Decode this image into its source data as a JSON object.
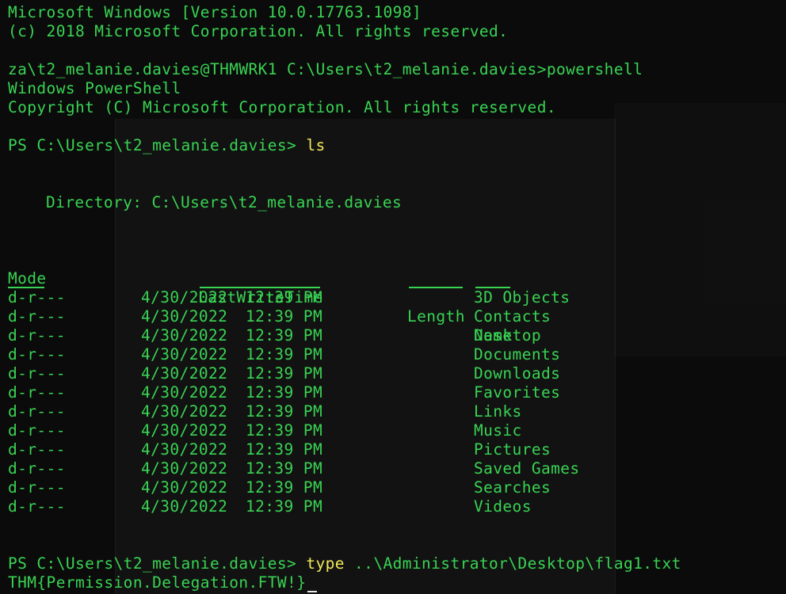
{
  "header": {
    "line1": "Microsoft Windows [Version 10.0.17763.1098]",
    "line2": "(c) 2018 Microsoft Corporation. All rights reserved."
  },
  "session": {
    "cmd_prompt": "za\\t2_melanie.davies@THMWRK1 C:\\Users\\t2_melanie.davies>",
    "cmd_command": "powershell",
    "ps_title": "Windows PowerShell",
    "ps_copyright": "Copyright (C) Microsoft Corporation. All rights reserved.",
    "ps_prompt": "PS C:\\Users\\t2_melanie.davies> ",
    "ls_command": "ls",
    "type_command": "type",
    "type_arg": "..\\Administrator\\Desktop\\flag1.txt",
    "flag_output": "THM{Permission.Delegation.FTW!}"
  },
  "listing": {
    "directory_label": "Directory: C:\\Users\\t2_melanie.davies",
    "headers": {
      "mode": "Mode",
      "last_write_time": "LastWriteTime",
      "length": "Length",
      "name": "Name"
    },
    "rows": [
      {
        "mode": "d-r---",
        "date": "4/30/2022",
        "time": "12:39 PM",
        "length": "",
        "name": "3D Objects"
      },
      {
        "mode": "d-r---",
        "date": "4/30/2022",
        "time": "12:39 PM",
        "length": "",
        "name": "Contacts"
      },
      {
        "mode": "d-r---",
        "date": "4/30/2022",
        "time": "12:39 PM",
        "length": "",
        "name": "Desktop"
      },
      {
        "mode": "d-r---",
        "date": "4/30/2022",
        "time": "12:39 PM",
        "length": "",
        "name": "Documents"
      },
      {
        "mode": "d-r---",
        "date": "4/30/2022",
        "time": "12:39 PM",
        "length": "",
        "name": "Downloads"
      },
      {
        "mode": "d-r---",
        "date": "4/30/2022",
        "time": "12:39 PM",
        "length": "",
        "name": "Favorites"
      },
      {
        "mode": "d-r---",
        "date": "4/30/2022",
        "time": "12:39 PM",
        "length": "",
        "name": "Links"
      },
      {
        "mode": "d-r---",
        "date": "4/30/2022",
        "time": "12:39 PM",
        "length": "",
        "name": "Music"
      },
      {
        "mode": "d-r---",
        "date": "4/30/2022",
        "time": "12:39 PM",
        "length": "",
        "name": "Pictures"
      },
      {
        "mode": "d-r---",
        "date": "4/30/2022",
        "time": "12:39 PM",
        "length": "",
        "name": "Saved Games"
      },
      {
        "mode": "d-r---",
        "date": "4/30/2022",
        "time": "12:39 PM",
        "length": "",
        "name": "Searches"
      },
      {
        "mode": "d-r---",
        "date": "4/30/2022",
        "time": "12:39 PM",
        "length": "",
        "name": "Videos"
      }
    ]
  },
  "colors": {
    "background": "#0b0b0b",
    "output_text": "#39d353",
    "command_text": "#f2e85a",
    "cursor": "#e8e8e8"
  }
}
